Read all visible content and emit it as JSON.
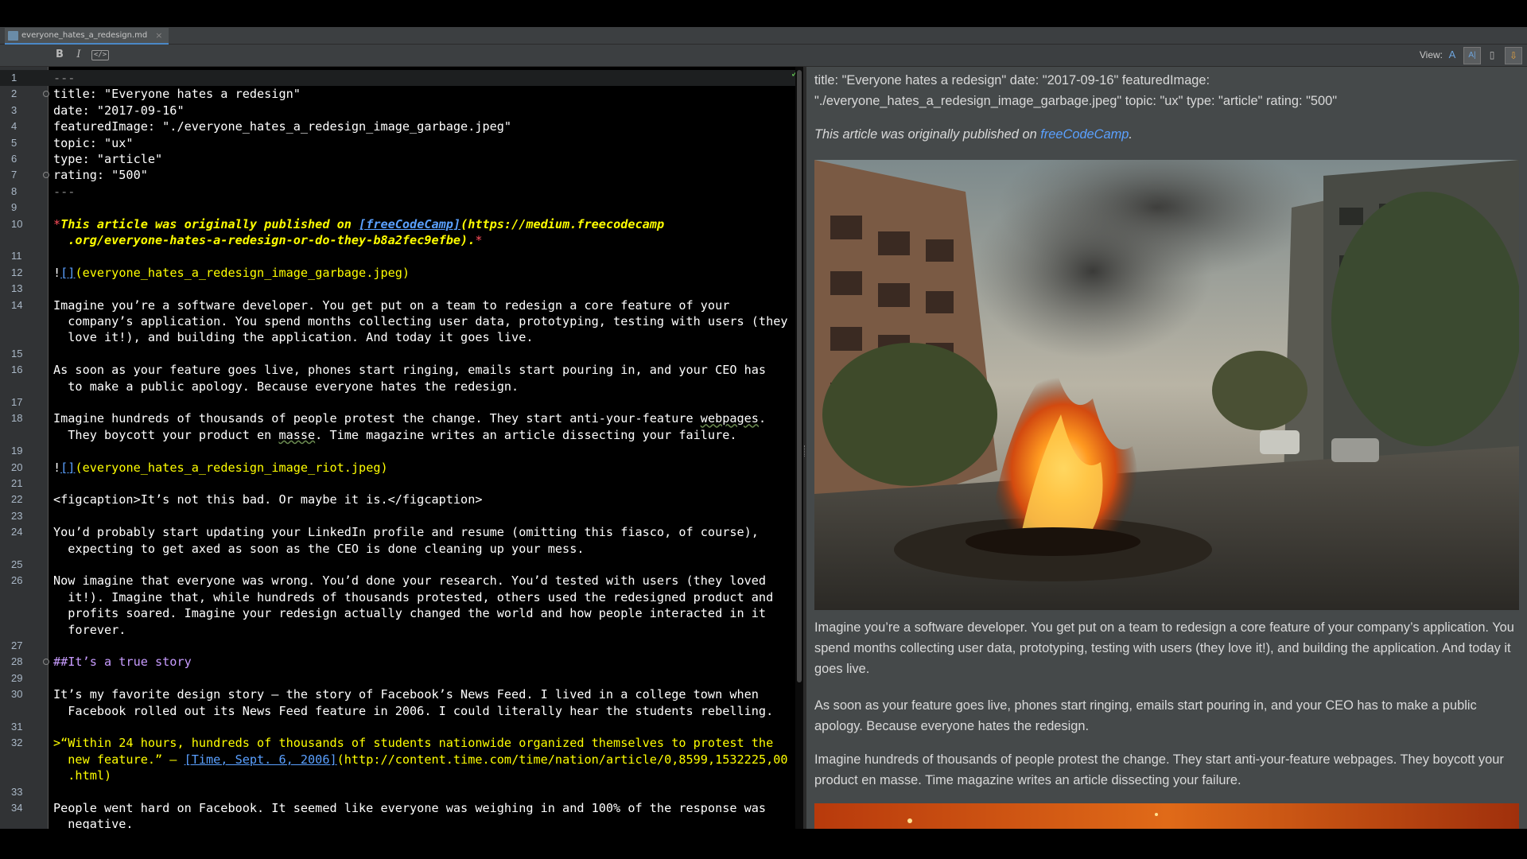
{
  "tab": {
    "title": "everyone_hates_a_redesign.md",
    "close": "×"
  },
  "toolbar": {
    "bold": "B",
    "italic": "I",
    "code": "</>",
    "view_label": "View:",
    "view_editor": "A",
    "view_split": "A|",
    "view_preview": "▯",
    "view_extra": "⇩"
  },
  "editor": {
    "check": "✓",
    "lines": [
      {
        "n": "1",
        "segs": [
          {
            "t": "---",
            "c": "c-dash"
          }
        ]
      },
      {
        "n": "2",
        "segs": [
          {
            "t": "title: \"Everyone hates a redesign\"",
            "c": "c-front"
          }
        ]
      },
      {
        "n": "3",
        "segs": [
          {
            "t": "date: \"2017-09-16\"",
            "c": "c-front"
          }
        ]
      },
      {
        "n": "4",
        "segs": [
          {
            "t": "featuredImage: \"./everyone_hates_a_redesign_image_garbage.jpeg\"",
            "c": "c-front"
          }
        ]
      },
      {
        "n": "5",
        "segs": [
          {
            "t": "topic: \"ux\"",
            "c": "c-front"
          }
        ]
      },
      {
        "n": "6",
        "segs": [
          {
            "t": "type: \"article\"",
            "c": "c-front"
          }
        ]
      },
      {
        "n": "7",
        "segs": [
          {
            "t": "rating: \"500\"",
            "c": "c-front"
          }
        ]
      },
      {
        "n": "8",
        "segs": [
          {
            "t": "---",
            "c": "c-dash"
          }
        ]
      },
      {
        "n": "9",
        "segs": []
      },
      {
        "n": "10",
        "segs": [
          {
            "t": "*",
            "c": "c-star"
          },
          {
            "t": "This article was originally published on ",
            "c": "c-ital"
          },
          {
            "t": "[freeCodeCamp]",
            "c": "c-link c-ital"
          },
          {
            "t": "(https://medium.freecodecamp",
            "c": "c-ital"
          }
        ]
      },
      {
        "n": "",
        "segs": [
          {
            "t": "  .org/everyone-hates-a-redesign-or-do-they-b8a2fec9efbe).",
            "c": "c-ital"
          },
          {
            "t": "*",
            "c": "c-star"
          }
        ]
      },
      {
        "n": "11",
        "segs": []
      },
      {
        "n": "12",
        "segs": [
          {
            "t": "!",
            "c": "c-front"
          },
          {
            "t": "[]",
            "c": "c-link"
          },
          {
            "t": "(everyone_hates_a_redesign_image_garbage.jpeg)",
            "c": "c-img"
          }
        ]
      },
      {
        "n": "13",
        "segs": []
      },
      {
        "n": "14",
        "segs": [
          {
            "t": "Imagine you’re a software developer. You get put on a team to redesign a core feature of your",
            "c": "c-front"
          }
        ]
      },
      {
        "n": "",
        "segs": [
          {
            "t": "  company’s application. You spend months collecting user data, prototyping, testing with users (they",
            "c": "c-front"
          }
        ]
      },
      {
        "n": "",
        "segs": [
          {
            "t": "  love it!), and building the application. And today it goes live.",
            "c": "c-front"
          }
        ]
      },
      {
        "n": "15",
        "segs": []
      },
      {
        "n": "16",
        "segs": [
          {
            "t": "As soon as your feature goes live, phones start ringing, emails start pouring in, and your CEO has",
            "c": "c-front"
          }
        ]
      },
      {
        "n": "",
        "segs": [
          {
            "t": "  to make a public apology. Because everyone hates the redesign.",
            "c": "c-front"
          }
        ]
      },
      {
        "n": "17",
        "segs": []
      },
      {
        "n": "18",
        "segs": [
          {
            "t": "Imagine hundreds of thousands of people protest the change. They start anti-your-feature ",
            "c": "c-front"
          },
          {
            "t": "webpages",
            "c": "c-front sp"
          },
          {
            "t": ".",
            "c": "c-front"
          }
        ]
      },
      {
        "n": "",
        "segs": [
          {
            "t": "  They boycott your product en ",
            "c": "c-front"
          },
          {
            "t": "masse",
            "c": "c-front sp"
          },
          {
            "t": ". Time magazine writes an article dissecting your failure.",
            "c": "c-front"
          }
        ]
      },
      {
        "n": "19",
        "segs": []
      },
      {
        "n": "20",
        "segs": [
          {
            "t": "!",
            "c": "c-front"
          },
          {
            "t": "[]",
            "c": "c-link"
          },
          {
            "t": "(everyone_hates_a_redesign_image_riot.jpeg)",
            "c": "c-img"
          }
        ]
      },
      {
        "n": "21",
        "segs": []
      },
      {
        "n": "22",
        "segs": [
          {
            "t": "<figcaption>It’s not this bad. Or maybe it is.</figcaption>",
            "c": "c-tag"
          }
        ]
      },
      {
        "n": "23",
        "segs": []
      },
      {
        "n": "24",
        "segs": [
          {
            "t": "You’d probably start updating your LinkedIn profile and resume (omitting this fiasco, of course),",
            "c": "c-front"
          }
        ]
      },
      {
        "n": "",
        "segs": [
          {
            "t": "  expecting to get axed as soon as the CEO is done cleaning up your mess.",
            "c": "c-front"
          }
        ]
      },
      {
        "n": "25",
        "segs": []
      },
      {
        "n": "26",
        "segs": [
          {
            "t": "Now imagine that everyone was wrong. You’d done your research. You’d tested with users (they loved",
            "c": "c-front"
          }
        ]
      },
      {
        "n": "",
        "segs": [
          {
            "t": "  it!). Imagine that, while hundreds of thousands protested, others used the redesigned product and",
            "c": "c-front"
          }
        ]
      },
      {
        "n": "",
        "segs": [
          {
            "t": "  profits soared. Imagine your redesign actually changed the world and how people interacted in it",
            "c": "c-front"
          }
        ]
      },
      {
        "n": "",
        "segs": [
          {
            "t": "  forever.",
            "c": "c-front"
          }
        ]
      },
      {
        "n": "27",
        "segs": []
      },
      {
        "n": "28",
        "segs": [
          {
            "t": "##It’s a true story",
            "c": "c-head"
          }
        ]
      },
      {
        "n": "29",
        "segs": []
      },
      {
        "n": "30",
        "segs": [
          {
            "t": "It’s my favorite design story — the story of Facebook’s News Feed. I lived in a college town when",
            "c": "c-front"
          }
        ]
      },
      {
        "n": "",
        "segs": [
          {
            "t": "  Facebook rolled out its News Feed feature in 2006. I could literally hear the students rebelling.",
            "c": "c-front"
          }
        ]
      },
      {
        "n": "31",
        "segs": []
      },
      {
        "n": "32",
        "segs": [
          {
            "t": ">“Within 24 hours, hundreds of thousands of students nationwide organized themselves to protest the",
            "c": "c-quote"
          }
        ]
      },
      {
        "n": "",
        "segs": [
          {
            "t": "  new feature.” — ",
            "c": "c-quote"
          },
          {
            "t": "[Time, Sept. 6, 2006]",
            "c": "c-link"
          },
          {
            "t": "(http://content.time.com/time/nation/article/0,8599,1532225,00",
            "c": "c-quote"
          }
        ]
      },
      {
        "n": "",
        "segs": [
          {
            "t": "  .html)",
            "c": "c-quote"
          }
        ]
      },
      {
        "n": "33",
        "segs": []
      },
      {
        "n": "34",
        "segs": [
          {
            "t": "People went hard on Facebook. It seemed like everyone was weighing in and 100% of the response was",
            "c": "c-front"
          }
        ]
      },
      {
        "n": "",
        "segs": [
          {
            "t": "  negative.",
            "c": "c-front"
          }
        ]
      }
    ]
  },
  "preview": {
    "frontmatter": "title: \"Everyone hates a redesign\" date: \"2017-09-16\" featuredImage: \"./everyone_hates_a_redesign_image_garbage.jpeg\" topic: \"ux\" type: \"article\" rating: \"500\"",
    "published_prefix": "This article was originally published on ",
    "published_link": "freeCodeCamp",
    "published_suffix": ".",
    "p1": "Imagine you’re a software developer. You get put on a team to redesign a core feature of your company’s application. You spend months collecting user data, prototyping, testing with users (they love it!), and building the application. And today it goes live.",
    "p2": "As soon as your feature goes live, phones start ringing, emails start pouring in, and your CEO has to make a public apology. Because everyone hates the redesign.",
    "p3": "Imagine hundreds of thousands of people protest the change. They start anti-your-feature webpages. They boycott your product en masse. Time magazine writes an article dissecting your failure."
  },
  "colors": {
    "accent": "#4a88c7",
    "link": "#5aa0ff",
    "string_yellow": "#ffff00",
    "heading": "#c89cff",
    "preview_bg": "#45494a"
  }
}
